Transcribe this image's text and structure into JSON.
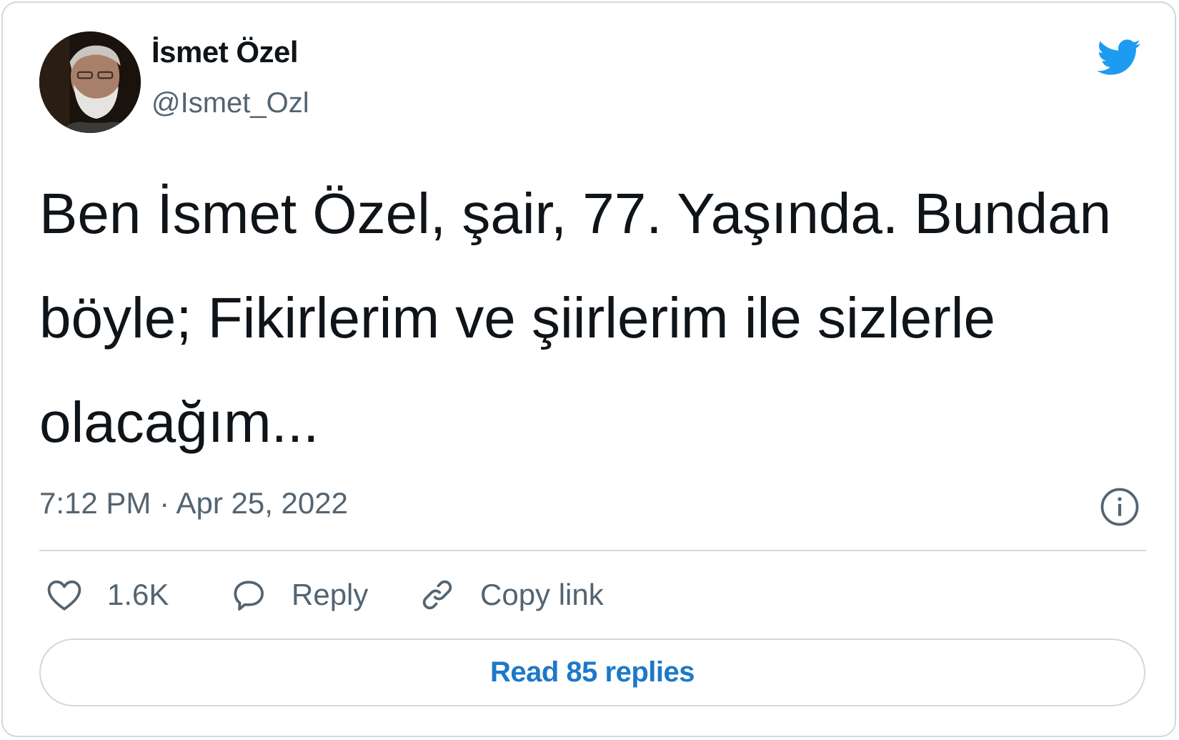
{
  "author": {
    "display_name": "İsmet Özel",
    "handle": "@Ismet_Ozl",
    "avatar_icon": "avatar-portrait"
  },
  "tweet": {
    "text": "Ben İsmet Özel, şair, 77. Yaşında. Bundan böyle; Fikirlerim ve şiirlerim ile sizlerle olacağım...",
    "time": "7:12 PM",
    "separator": "·",
    "date": "Apr 25, 2022"
  },
  "actions": {
    "like_count": "1.6K",
    "reply_label": "Reply",
    "copy_link_label": "Copy link"
  },
  "read_replies_label": "Read 85 replies",
  "colors": {
    "twitter_blue": "#1d9bf0",
    "link_blue": "#1d78c9",
    "text_primary": "#0f1419",
    "text_secondary": "#536471",
    "border": "#cfd9de"
  },
  "icons": [
    "twitter-bird-icon",
    "info-icon",
    "heart-icon",
    "reply-bubble-icon",
    "link-icon"
  ]
}
